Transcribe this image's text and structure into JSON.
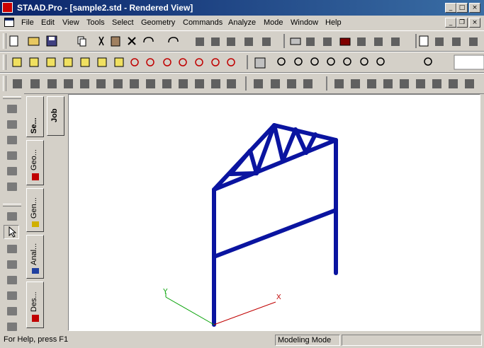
{
  "window": {
    "title": "STAAD.Pro - [sample2.std - Rendered View]"
  },
  "menu": [
    "File",
    "Edit",
    "View",
    "Tools",
    "Select",
    "Geometry",
    "Commands",
    "Analyze",
    "Mode",
    "Window",
    "Help"
  ],
  "tabs": {
    "setup": "Se...",
    "geometry": "Geo...",
    "general": "Gen...",
    "analysis": "Anal...",
    "design": "Des...",
    "job": "Job"
  },
  "axes": {
    "x": "X",
    "y": "Y"
  },
  "status": {
    "help": "For Help, press F1",
    "mode": "Modeling Mode"
  },
  "colors": {
    "structure": "#0a14a0",
    "title_start": "#0a246a",
    "title_end": "#3a6ea5"
  }
}
